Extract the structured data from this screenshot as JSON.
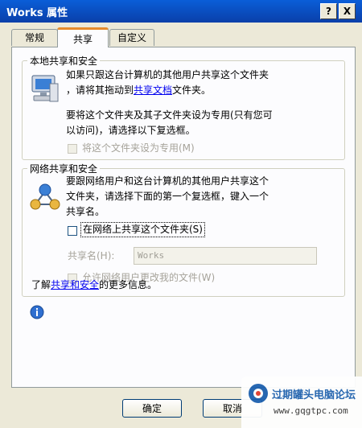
{
  "window": {
    "title": "Works 属性",
    "help_btn": "?",
    "close_btn": "X"
  },
  "tabs": [
    {
      "label": "常规"
    },
    {
      "label": "共享"
    },
    {
      "label": "自定义"
    }
  ],
  "local": {
    "legend": "本地共享和安全",
    "line1": "如果只跟这台计算机的其他用户共享这个文件夹",
    "line2_pre": "，请将其拖动到",
    "line2_link": "共享文档",
    "line2_post": "文件夹。",
    "private_line1": "要将这个文件夹及其子文件夹设为专用(只有您可",
    "private_line2": "以访问)，请选择以下复选框。",
    "checkbox_label": "将这个文件夹设为专用(M)"
  },
  "network": {
    "legend": "网络共享和安全",
    "line1": "要跟网络用户和这台计算机的其他用户共享这个",
    "line2": "文件夹，请选择下面的第一个复选框，键入一个",
    "line3": "共享名。",
    "share_checkbox_label": "在网络上共享这个文件夹(S)",
    "share_name_label": "共享名(H):",
    "share_name_value": "Works",
    "allow_change_label": "允许网络用户更改我的文件(W)"
  },
  "learn_more": {
    "pre": "了解",
    "link": "共享和安全",
    "post": "的更多信息。"
  },
  "buttons": {
    "ok": "确定",
    "cancel": "取消"
  },
  "watermark": {
    "text": "过期罐头电脑论坛",
    "url": "www.gqgtpc.com"
  },
  "colors": {
    "titlebar": "#0a4fc4",
    "window_bg": "#ece9d8",
    "tab_highlight": "#e68b2c",
    "link": "#0000ee"
  }
}
